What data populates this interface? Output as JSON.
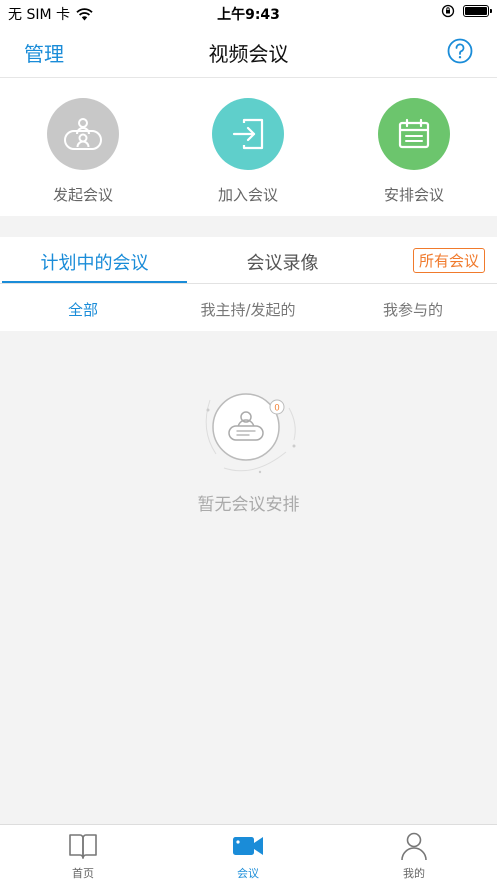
{
  "status_bar": {
    "carrier": "无 SIM 卡",
    "time": "上午9:43"
  },
  "nav": {
    "left_label": "管理",
    "title": "视频会议"
  },
  "actions": [
    {
      "label": "发起会议",
      "color": "#c8c8c8",
      "icon": "video-conference-icon"
    },
    {
      "label": "加入会议",
      "color": "#5fcfcb",
      "icon": "join-arrow-icon"
    },
    {
      "label": "安排会议",
      "color": "#6cc56d",
      "icon": "calendar-icon"
    }
  ],
  "tabs": {
    "planned": "计划中的会议",
    "recordings": "会议录像",
    "all_meetings": "所有会议"
  },
  "subtabs": {
    "all": "全部",
    "hosted": "我主持/发起的",
    "joined": "我参与的"
  },
  "empty_state": {
    "badge_count": "0",
    "message": "暂无会议安排"
  },
  "tabbar": {
    "home": "首页",
    "meetings": "会议",
    "mine": "我的"
  },
  "colors": {
    "accent": "#1a8cd8",
    "orange": "#f07a2c"
  }
}
